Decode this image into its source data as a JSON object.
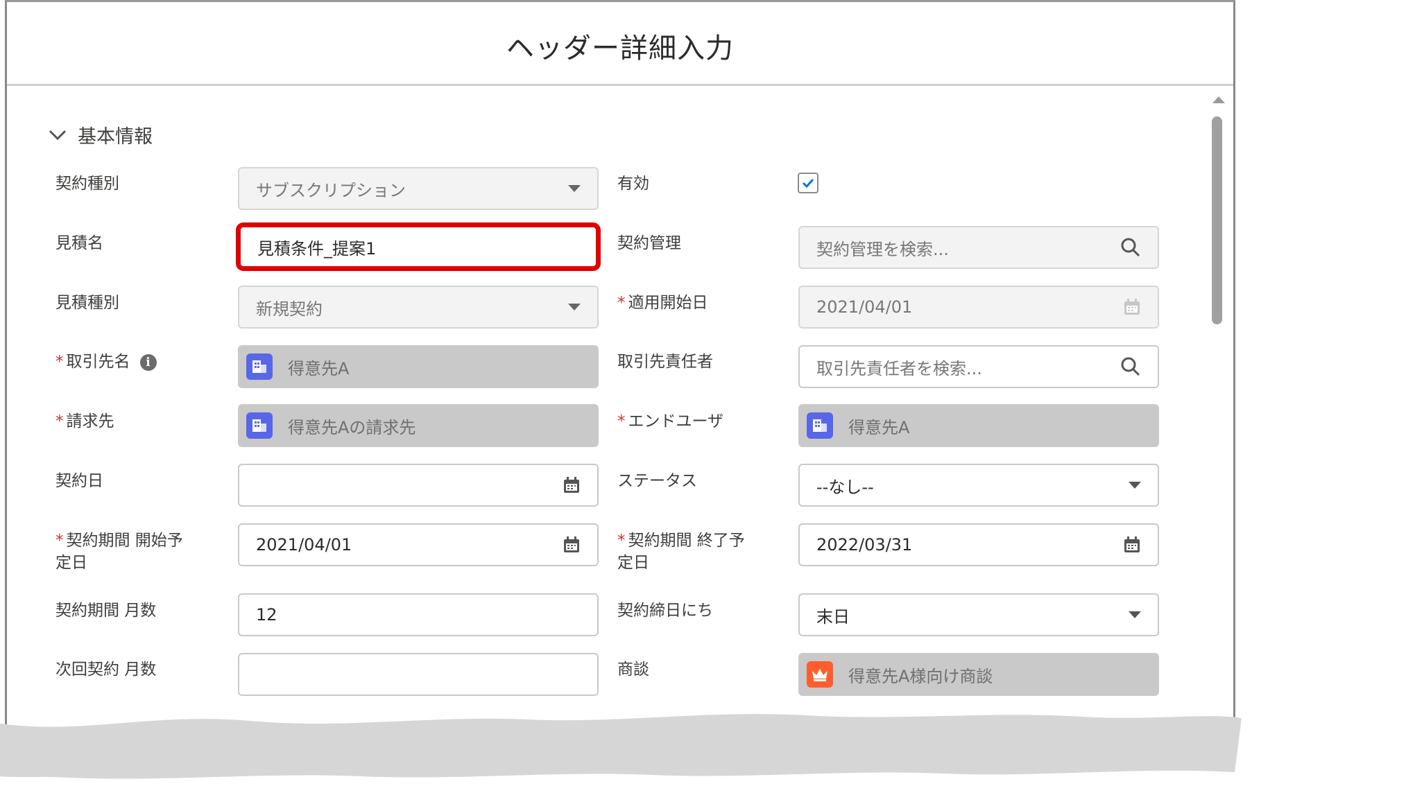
{
  "dialog": {
    "title": "ヘッダー詳細入力"
  },
  "section": {
    "title": "基本情報"
  },
  "fields": {
    "contract_type": {
      "label": "契約種別",
      "value": "サブスクリプション"
    },
    "active": {
      "label": "有効",
      "checked": true
    },
    "quote_name": {
      "label": "見積名",
      "value": "見積条件_提案1"
    },
    "contract_mgmt": {
      "label": "契約管理",
      "placeholder": "契約管理を検索..."
    },
    "quote_type": {
      "label": "見積種別",
      "value": "新規契約"
    },
    "apply_start": {
      "label": "適用開始日",
      "required": "*",
      "value": "2021/04/01"
    },
    "account": {
      "label": "取引先名",
      "required": "*",
      "value": "得意先A"
    },
    "account_contact": {
      "label": "取引先責任者",
      "placeholder": "取引先責任者を検索..."
    },
    "billing": {
      "label": "請求先",
      "required": "*",
      "value": "得意先Aの請求先"
    },
    "end_user": {
      "label": "エンドユーザ",
      "required": "*",
      "value": "得意先A"
    },
    "contract_date": {
      "label": "契約日",
      "value": ""
    },
    "status": {
      "label": "ステータス",
      "value": "--なし--"
    },
    "period_start": {
      "label_line1": "契約期間 開始予",
      "label_line2": "定日",
      "required": "*",
      "value": "2021/04/01"
    },
    "period_end": {
      "label_line1": "契約期間 終了予",
      "label_line2": "定日",
      "required": "*",
      "value": "2022/03/31"
    },
    "period_months": {
      "label": "契約期間 月数",
      "value": "12"
    },
    "closing_day": {
      "label": "契約締日にち",
      "value": "末日"
    },
    "next_months": {
      "label": "次回契約 月数",
      "value": ""
    },
    "opportunity": {
      "label": "商談",
      "value": "得意先A様向け商談"
    }
  },
  "icons": [
    "chevron-down-icon",
    "info-icon",
    "calendar-icon",
    "search-icon",
    "account-icon",
    "opportunity-icon",
    "checkmark-icon",
    "dropdown-caret-icon"
  ],
  "colors": {
    "highlight": "#e00000",
    "account_icon": "#5867e8",
    "opportunity_icon": "#ff5d2d",
    "required": "#c23934",
    "checkbox_check": "#0176d3"
  }
}
